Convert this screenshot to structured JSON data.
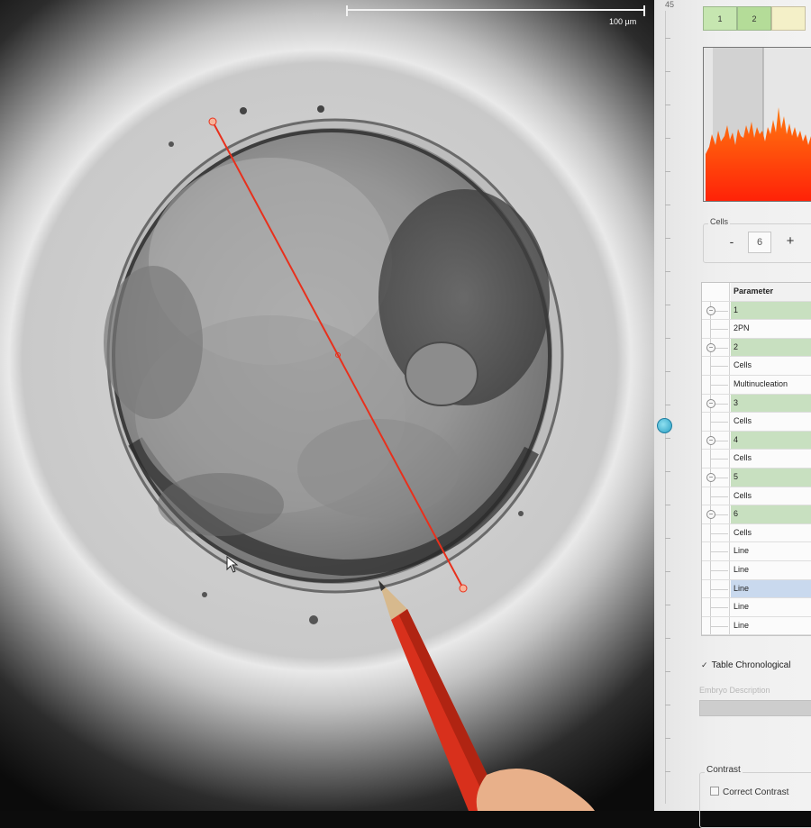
{
  "viewer": {
    "scale_label": "100 µm"
  },
  "panel": {
    "ruler_label": "45",
    "tabs": [
      "1",
      "2",
      ""
    ],
    "cells_group": {
      "label": "Cells",
      "minus": "-",
      "count": "6",
      "plus": "+"
    },
    "table": {
      "header": "Parameter",
      "rows": [
        {
          "label": "1",
          "kind": "group"
        },
        {
          "label": "2PN",
          "kind": "child"
        },
        {
          "label": "2",
          "kind": "group"
        },
        {
          "label": "Cells",
          "kind": "child"
        },
        {
          "label": "Multinucleation",
          "kind": "child"
        },
        {
          "label": "3",
          "kind": "group"
        },
        {
          "label": "Cells",
          "kind": "child"
        },
        {
          "label": "4",
          "kind": "group"
        },
        {
          "label": "Cells",
          "kind": "child"
        },
        {
          "label": "5",
          "kind": "group"
        },
        {
          "label": "Cells",
          "kind": "child"
        },
        {
          "label": "6",
          "kind": "group"
        },
        {
          "label": "Cells",
          "kind": "child"
        },
        {
          "label": "Line",
          "kind": "child"
        },
        {
          "label": "Line",
          "kind": "child"
        },
        {
          "label": "Line",
          "kind": "selected"
        },
        {
          "label": "Line",
          "kind": "child"
        },
        {
          "label": "Line",
          "kind": "child"
        }
      ]
    },
    "table_chronological": {
      "checked": true,
      "check_glyph": "✓",
      "label": "Table Chronological"
    },
    "embryo_description_label": "Embryo Description",
    "contrast": {
      "label": "Contrast",
      "correct_contrast_label": "Correct Contrast",
      "correct_contrast_checked": false
    }
  },
  "colors": {
    "measurement_line": "#e8301c",
    "histogram_fill": "#ff3a10",
    "group_row": "#c8e0c0",
    "selected_row": "#c9d9ee",
    "slider_knob": "#2b9fc4"
  }
}
